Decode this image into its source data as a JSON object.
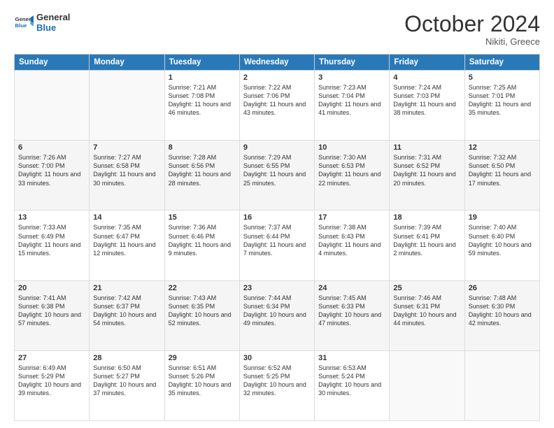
{
  "logo": {
    "text_general": "General",
    "text_blue": "Blue"
  },
  "header": {
    "month": "October 2024",
    "location": "Nikiti, Greece"
  },
  "weekdays": [
    "Sunday",
    "Monday",
    "Tuesday",
    "Wednesday",
    "Thursday",
    "Friday",
    "Saturday"
  ],
  "weeks": [
    [
      {
        "day": "",
        "sunrise": "",
        "sunset": "",
        "daylight": ""
      },
      {
        "day": "",
        "sunrise": "",
        "sunset": "",
        "daylight": ""
      },
      {
        "day": "1",
        "sunrise": "Sunrise: 7:21 AM",
        "sunset": "Sunset: 7:08 PM",
        "daylight": "Daylight: 11 hours and 46 minutes."
      },
      {
        "day": "2",
        "sunrise": "Sunrise: 7:22 AM",
        "sunset": "Sunset: 7:06 PM",
        "daylight": "Daylight: 11 hours and 43 minutes."
      },
      {
        "day": "3",
        "sunrise": "Sunrise: 7:23 AM",
        "sunset": "Sunset: 7:04 PM",
        "daylight": "Daylight: 11 hours and 41 minutes."
      },
      {
        "day": "4",
        "sunrise": "Sunrise: 7:24 AM",
        "sunset": "Sunset: 7:03 PM",
        "daylight": "Daylight: 11 hours and 38 minutes."
      },
      {
        "day": "5",
        "sunrise": "Sunrise: 7:25 AM",
        "sunset": "Sunset: 7:01 PM",
        "daylight": "Daylight: 11 hours and 35 minutes."
      }
    ],
    [
      {
        "day": "6",
        "sunrise": "Sunrise: 7:26 AM",
        "sunset": "Sunset: 7:00 PM",
        "daylight": "Daylight: 11 hours and 33 minutes."
      },
      {
        "day": "7",
        "sunrise": "Sunrise: 7:27 AM",
        "sunset": "Sunset: 6:58 PM",
        "daylight": "Daylight: 11 hours and 30 minutes."
      },
      {
        "day": "8",
        "sunrise": "Sunrise: 7:28 AM",
        "sunset": "Sunset: 6:56 PM",
        "daylight": "Daylight: 11 hours and 28 minutes."
      },
      {
        "day": "9",
        "sunrise": "Sunrise: 7:29 AM",
        "sunset": "Sunset: 6:55 PM",
        "daylight": "Daylight: 11 hours and 25 minutes."
      },
      {
        "day": "10",
        "sunrise": "Sunrise: 7:30 AM",
        "sunset": "Sunset: 6:53 PM",
        "daylight": "Daylight: 11 hours and 22 minutes."
      },
      {
        "day": "11",
        "sunrise": "Sunrise: 7:31 AM",
        "sunset": "Sunset: 6:52 PM",
        "daylight": "Daylight: 11 hours and 20 minutes."
      },
      {
        "day": "12",
        "sunrise": "Sunrise: 7:32 AM",
        "sunset": "Sunset: 6:50 PM",
        "daylight": "Daylight: 11 hours and 17 minutes."
      }
    ],
    [
      {
        "day": "13",
        "sunrise": "Sunrise: 7:33 AM",
        "sunset": "Sunset: 6:49 PM",
        "daylight": "Daylight: 11 hours and 15 minutes."
      },
      {
        "day": "14",
        "sunrise": "Sunrise: 7:35 AM",
        "sunset": "Sunset: 6:47 PM",
        "daylight": "Daylight: 11 hours and 12 minutes."
      },
      {
        "day": "15",
        "sunrise": "Sunrise: 7:36 AM",
        "sunset": "Sunset: 6:46 PM",
        "daylight": "Daylight: 11 hours and 9 minutes."
      },
      {
        "day": "16",
        "sunrise": "Sunrise: 7:37 AM",
        "sunset": "Sunset: 6:44 PM",
        "daylight": "Daylight: 11 hours and 7 minutes."
      },
      {
        "day": "17",
        "sunrise": "Sunrise: 7:38 AM",
        "sunset": "Sunset: 6:43 PM",
        "daylight": "Daylight: 11 hours and 4 minutes."
      },
      {
        "day": "18",
        "sunrise": "Sunrise: 7:39 AM",
        "sunset": "Sunset: 6:41 PM",
        "daylight": "Daylight: 11 hours and 2 minutes."
      },
      {
        "day": "19",
        "sunrise": "Sunrise: 7:40 AM",
        "sunset": "Sunset: 6:40 PM",
        "daylight": "Daylight: 10 hours and 59 minutes."
      }
    ],
    [
      {
        "day": "20",
        "sunrise": "Sunrise: 7:41 AM",
        "sunset": "Sunset: 6:38 PM",
        "daylight": "Daylight: 10 hours and 57 minutes."
      },
      {
        "day": "21",
        "sunrise": "Sunrise: 7:42 AM",
        "sunset": "Sunset: 6:37 PM",
        "daylight": "Daylight: 10 hours and 54 minutes."
      },
      {
        "day": "22",
        "sunrise": "Sunrise: 7:43 AM",
        "sunset": "Sunset: 6:35 PM",
        "daylight": "Daylight: 10 hours and 52 minutes."
      },
      {
        "day": "23",
        "sunrise": "Sunrise: 7:44 AM",
        "sunset": "Sunset: 6:34 PM",
        "daylight": "Daylight: 10 hours and 49 minutes."
      },
      {
        "day": "24",
        "sunrise": "Sunrise: 7:45 AM",
        "sunset": "Sunset: 6:33 PM",
        "daylight": "Daylight: 10 hours and 47 minutes."
      },
      {
        "day": "25",
        "sunrise": "Sunrise: 7:46 AM",
        "sunset": "Sunset: 6:31 PM",
        "daylight": "Daylight: 10 hours and 44 minutes."
      },
      {
        "day": "26",
        "sunrise": "Sunrise: 7:48 AM",
        "sunset": "Sunset: 6:30 PM",
        "daylight": "Daylight: 10 hours and 42 minutes."
      }
    ],
    [
      {
        "day": "27",
        "sunrise": "Sunrise: 6:49 AM",
        "sunset": "Sunset: 5:29 PM",
        "daylight": "Daylight: 10 hours and 39 minutes."
      },
      {
        "day": "28",
        "sunrise": "Sunrise: 6:50 AM",
        "sunset": "Sunset: 5:27 PM",
        "daylight": "Daylight: 10 hours and 37 minutes."
      },
      {
        "day": "29",
        "sunrise": "Sunrise: 6:51 AM",
        "sunset": "Sunset: 5:26 PM",
        "daylight": "Daylight: 10 hours and 35 minutes."
      },
      {
        "day": "30",
        "sunrise": "Sunrise: 6:52 AM",
        "sunset": "Sunset: 5:25 PM",
        "daylight": "Daylight: 10 hours and 32 minutes."
      },
      {
        "day": "31",
        "sunrise": "Sunrise: 6:53 AM",
        "sunset": "Sunset: 5:24 PM",
        "daylight": "Daylight: 10 hours and 30 minutes."
      },
      {
        "day": "",
        "sunrise": "",
        "sunset": "",
        "daylight": ""
      },
      {
        "day": "",
        "sunrise": "",
        "sunset": "",
        "daylight": ""
      }
    ]
  ]
}
